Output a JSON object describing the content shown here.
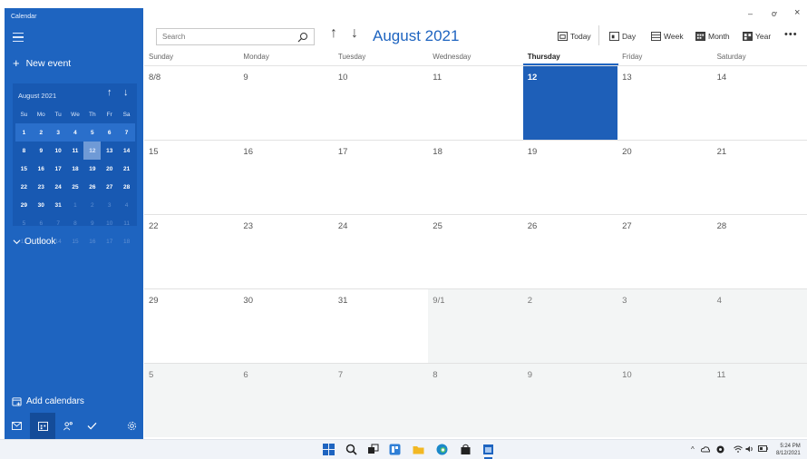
{
  "app": {
    "title": "Calendar"
  },
  "window": {
    "minimize": "–",
    "restore": "ơ",
    "close": "×"
  },
  "sidebar": {
    "new_event": "New event",
    "mini_calendar": {
      "header": "August 2021",
      "weekdays": [
        "Su",
        "Mo",
        "Tu",
        "We",
        "Th",
        "Fr",
        "Sa"
      ],
      "weeks": [
        [
          {
            "d": "1"
          },
          {
            "d": "2"
          },
          {
            "d": "3"
          },
          {
            "d": "4"
          },
          {
            "d": "5"
          },
          {
            "d": "6"
          },
          {
            "d": "7"
          }
        ],
        [
          {
            "d": "8"
          },
          {
            "d": "9"
          },
          {
            "d": "10"
          },
          {
            "d": "11"
          },
          {
            "d": "12",
            "today": true
          },
          {
            "d": "13"
          },
          {
            "d": "14"
          }
        ],
        [
          {
            "d": "15"
          },
          {
            "d": "16"
          },
          {
            "d": "17"
          },
          {
            "d": "18"
          },
          {
            "d": "19"
          },
          {
            "d": "20"
          },
          {
            "d": "21"
          }
        ],
        [
          {
            "d": "22"
          },
          {
            "d": "23"
          },
          {
            "d": "24"
          },
          {
            "d": "25"
          },
          {
            "d": "26"
          },
          {
            "d": "27"
          },
          {
            "d": "28"
          }
        ],
        [
          {
            "d": "29"
          },
          {
            "d": "30"
          },
          {
            "d": "31"
          },
          {
            "d": "1",
            "dim": true
          },
          {
            "d": "2",
            "dim": true
          },
          {
            "d": "3",
            "dim": true
          },
          {
            "d": "4",
            "dim": true
          }
        ],
        [
          {
            "d": "5",
            "dim": true
          },
          {
            "d": "6",
            "dim": true
          },
          {
            "d": "7",
            "dim": true
          },
          {
            "d": "8",
            "dim": true
          },
          {
            "d": "9",
            "dim": true
          },
          {
            "d": "10",
            "dim": true
          },
          {
            "d": "11",
            "dim": true
          }
        ],
        [
          {
            "d": "12",
            "dim": true
          },
          {
            "d": "13",
            "dim": true
          },
          {
            "d": "14",
            "dim": true
          },
          {
            "d": "15",
            "dim": true
          },
          {
            "d": "16",
            "dim": true
          },
          {
            "d": "17",
            "dim": true
          },
          {
            "d": "18",
            "dim": true
          }
        ]
      ]
    },
    "outlook": "Outlook",
    "add_calendars": "Add calendars"
  },
  "toolbar": {
    "search_placeholder": "Search",
    "month_title": "August 2021",
    "today": "Today",
    "day": "Day",
    "week": "Week",
    "month": "Month",
    "year": "Year",
    "more": "•••"
  },
  "calendar": {
    "weekdays": [
      "Sunday",
      "Monday",
      "Tuesday",
      "Wednesday",
      "Thursday",
      "Friday",
      "Saturday"
    ],
    "current_weekday": "Thursday",
    "weeks": [
      [
        {
          "d": "8/8"
        },
        {
          "d": "9"
        },
        {
          "d": "10"
        },
        {
          "d": "11"
        },
        {
          "d": "12",
          "selected": true
        },
        {
          "d": "13"
        },
        {
          "d": "14"
        }
      ],
      [
        {
          "d": "15"
        },
        {
          "d": "16"
        },
        {
          "d": "17"
        },
        {
          "d": "18"
        },
        {
          "d": "19"
        },
        {
          "d": "20"
        },
        {
          "d": "21"
        }
      ],
      [
        {
          "d": "22"
        },
        {
          "d": "23"
        },
        {
          "d": "24"
        },
        {
          "d": "25"
        },
        {
          "d": "26"
        },
        {
          "d": "27"
        },
        {
          "d": "28"
        }
      ],
      [
        {
          "d": "29"
        },
        {
          "d": "30"
        },
        {
          "d": "31"
        },
        {
          "d": "9/1",
          "other": true
        },
        {
          "d": "2",
          "other": true
        },
        {
          "d": "3",
          "other": true
        },
        {
          "d": "4",
          "other": true
        }
      ],
      [
        {
          "d": "5",
          "other": true
        },
        {
          "d": "6",
          "other": true
        },
        {
          "d": "7",
          "other": true
        },
        {
          "d": "8",
          "other": true
        },
        {
          "d": "9",
          "other": true
        },
        {
          "d": "10",
          "other": true
        },
        {
          "d": "11",
          "other": true
        }
      ]
    ]
  },
  "colors": {
    "accent": "#1e64c0",
    "sidebar": "#1e64c0",
    "selected_day": "#1e5fb8",
    "other_month": "#f3f5f5"
  },
  "taskbar": {
    "icons": [
      "windows-start-icon",
      "search-icon",
      "task-view-icon",
      "widgets-icon",
      "file-explorer-icon",
      "edge-icon",
      "store-icon",
      "calendar-app-icon"
    ],
    "clock_time": "5:24 PM",
    "clock_date": "8/12/2021"
  }
}
